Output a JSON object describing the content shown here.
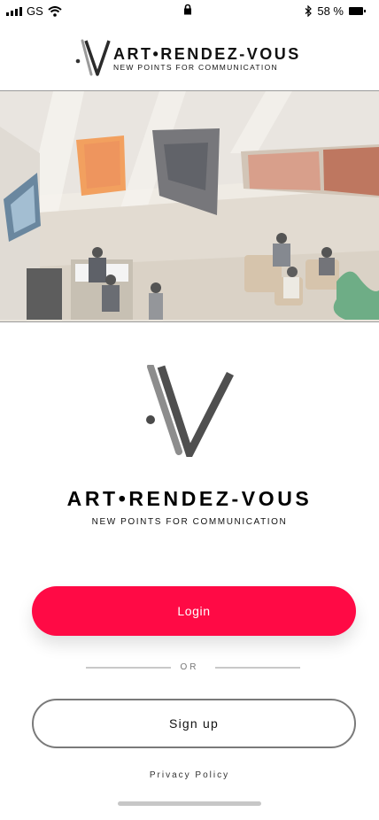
{
  "status_bar": {
    "carrier": "GS",
    "battery_text": "58 %",
    "icons": [
      "signal-icon",
      "wifi-icon",
      "lock-icon",
      "bluetooth-icon",
      "battery-icon"
    ]
  },
  "header": {
    "brand": "ART•RENDEZ-VOUS",
    "tagline": "NEW POINTS FOR COMMUNICATION"
  },
  "hero": {
    "image": "gallery-interior-photo"
  },
  "brand_block": {
    "brand": "ART•RENDEZ-VOUS",
    "tagline": "NEW POINTS FOR COMMUNICATION"
  },
  "actions": {
    "login_label": "Login",
    "or_label": "OR",
    "signup_label": "Sign up",
    "privacy_label": "Privacy Policy"
  },
  "colors": {
    "accent": "#ff0a45",
    "signup_border": "#7a7a7a",
    "divider": "#c8c8c8"
  }
}
